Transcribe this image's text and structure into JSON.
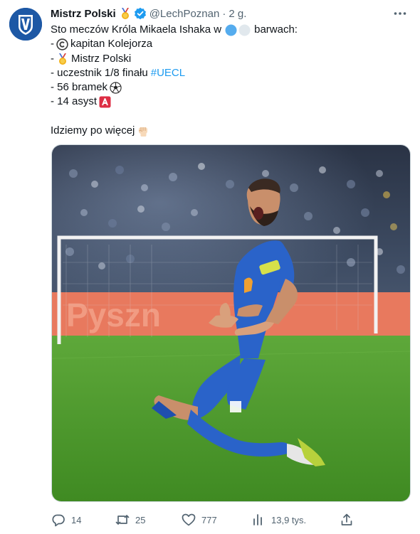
{
  "tweet": {
    "author_name": "Mistrz Polski",
    "handle": "@LechPoznan",
    "separator": "·",
    "time": "2 g.",
    "lines": {
      "l1_a": "Sto meczów Króla Mikaela Ishaka w",
      "l1_b": "barwach:",
      "l2_a": "-",
      "l2_b": "kapitan Kolejorza",
      "l3_a": "-",
      "l3_b": "Mistrz Polski",
      "l4_a": "- uczestnik 1/8 finału",
      "l4_tag": "#UECL",
      "l5": "- 56 bramek",
      "l6": "- 14 asyst",
      "l8": "Idziemy po więcej"
    }
  },
  "colors": {
    "club_blue": "#1d58a5",
    "hashtag": "#1d9bf0",
    "verified": "#1d9bf0",
    "muted": "#536471",
    "pitch_green": "#4f9a2a",
    "kit_blue": "#2a63c9"
  },
  "icons": {
    "medal": "gold-medal-emoji",
    "verified": "verified-badge-icon",
    "more": "more-dots-icon",
    "blue_circle": "blue-circle-emoji",
    "white_circle": "white-circle-emoji",
    "copyright": "copyright-emoji",
    "soccer": "soccer-ball-emoji",
    "a_button": "a-button-emoji",
    "fist": "raised-fist-emoji",
    "reply": "reply-icon",
    "retweet": "retweet-icon",
    "like": "heart-icon",
    "views": "views-icon",
    "share": "share-icon"
  },
  "actions": {
    "replies": "14",
    "retweets": "25",
    "likes": "777",
    "views": "13,9 tys."
  }
}
